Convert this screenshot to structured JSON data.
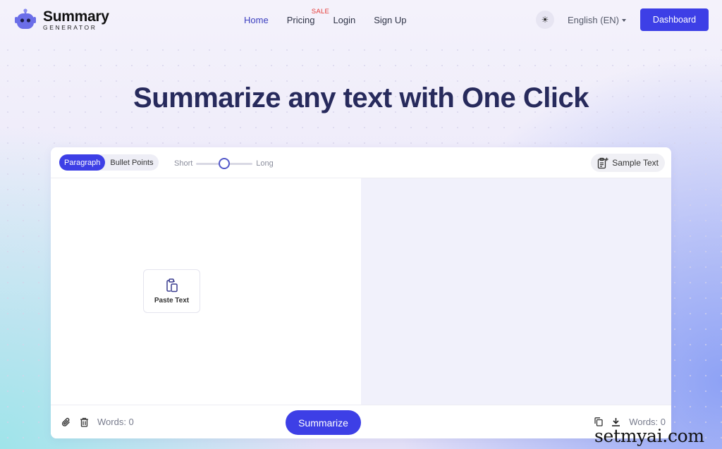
{
  "brand": {
    "title": "Summary",
    "subtitle": "GENERATOR",
    "accent": "#3d3fe6"
  },
  "nav": {
    "items": [
      {
        "label": "Home",
        "active": true
      },
      {
        "label": "Pricing",
        "badge": "SALE"
      },
      {
        "label": "Login"
      },
      {
        "label": "Sign Up"
      }
    ],
    "theme_icon": "☀",
    "language": "English (EN)",
    "dashboard_label": "Dashboard"
  },
  "hero": {
    "title": "Summarize any text with One Click"
  },
  "editor": {
    "modes": [
      "Paragraph",
      "Bullet Points"
    ],
    "selected_mode": "Paragraph",
    "length": {
      "min_label": "Short",
      "max_label": "Long",
      "value": 0.5
    },
    "sample_label": "Sample Text",
    "paste_label": "Paste Text",
    "summarize_label": "Summarize",
    "input_words": "Words: 0",
    "output_words": "Words: 0"
  },
  "watermark": "setmyai.com"
}
